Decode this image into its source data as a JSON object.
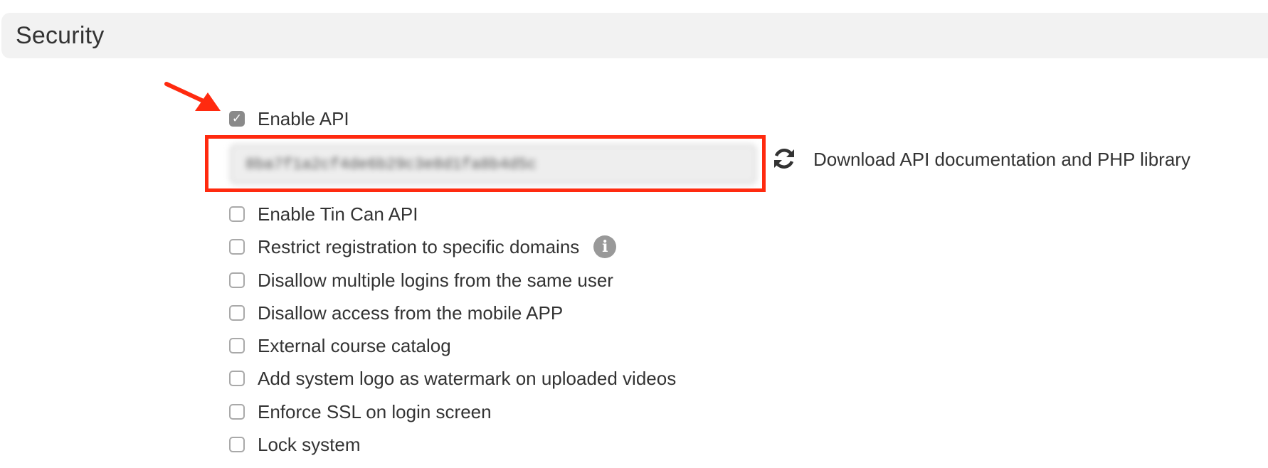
{
  "section": {
    "title": "Security"
  },
  "api": {
    "enable_label": "Enable API",
    "enabled": true,
    "key_value": "8ba7f1a2cf4de6b29c3e8d1fa8b4d5c",
    "download_label": "Download API documentation and PHP library"
  },
  "options": [
    {
      "label": "Enable Tin Can API",
      "checked": false
    },
    {
      "label": "Restrict registration to specific domains",
      "checked": false
    },
    {
      "label": "Disallow multiple logins from the same user",
      "checked": false
    },
    {
      "label": "Disallow access from the mobile APP",
      "checked": false
    },
    {
      "label": "External course catalog",
      "checked": false
    },
    {
      "label": "Add system logo as watermark on uploaded videos",
      "checked": false
    },
    {
      "label": "Enforce SSL on login screen",
      "checked": false
    },
    {
      "label": "Lock system",
      "checked": false
    }
  ],
  "icons": {
    "enable_api_check": "check-icon",
    "info": "info-icon",
    "refresh": "refresh-icon",
    "annotation_arrow": "arrow-icon"
  },
  "colors": {
    "highlight": "#ff2a0f",
    "header_bg": "#f2f2f2",
    "checked_bg": "#8a8a8a"
  }
}
